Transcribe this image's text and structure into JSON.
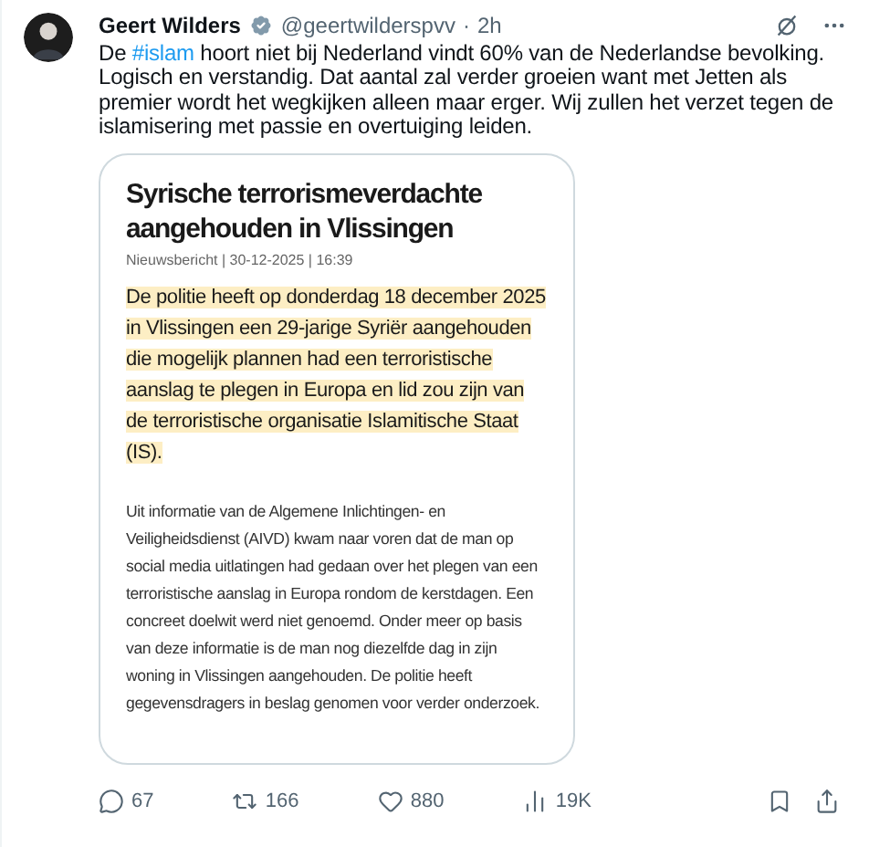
{
  "post": {
    "author": {
      "name": "Geert Wilders",
      "verified": true,
      "handle": "@geertwilderspvv",
      "separator": "·",
      "time": "2h"
    },
    "text": [
      {
        "kind": "text",
        "text": "De "
      },
      {
        "kind": "hashtag",
        "text": "#islam"
      },
      {
        "kind": "text",
        "text": " hoort niet bij Nederland vindt 60% van de Nederlandse bevolking. Logisch en verstandig. Dat aantal zal verder groeien want met Jetten als premier wordt het wegkijken alleen maar erger. Wij zullen het verzet tegen de islamisering met passie en overtuiging leiden."
      }
    ],
    "attachment": {
      "title": "Syrische terrorismeverdachte aangehouden in Vlissingen",
      "meta": "Nieuwsbericht | 30-12-2025 | 16:39",
      "lead": "De politie heeft op donderdag 18 december 2025 in Vlissingen een 29-jarige Syriër aangehouden die mogelijk plannen had een terroristische aanslag te plegen in Europa en lid zou zijn van de terroristische organisatie Islamitische Staat (IS).",
      "body": "Uit informatie van de Algemene Inlichtingen- en Veiligheidsdienst (AIVD) kwam naar voren dat de man op social media uitlatingen had gedaan over het plegen van een terroristische aanslag in Europa rondom de kerstdagen. Een concreet doelwit werd niet genoemd. Onder meer op basis van deze informatie is de man nog diezelfde dag in zijn woning in Vlissingen aangehouden. De politie heeft gegevensdragers in beslag genomen voor verder onderzoek."
    },
    "actions": [
      {
        "kind": "reply",
        "count": "67"
      },
      {
        "kind": "repost",
        "count": "166"
      },
      {
        "kind": "like",
        "count": "880"
      },
      {
        "kind": "views",
        "count": "19K"
      },
      {
        "kind": "bookmark"
      },
      {
        "kind": "share"
      }
    ]
  }
}
